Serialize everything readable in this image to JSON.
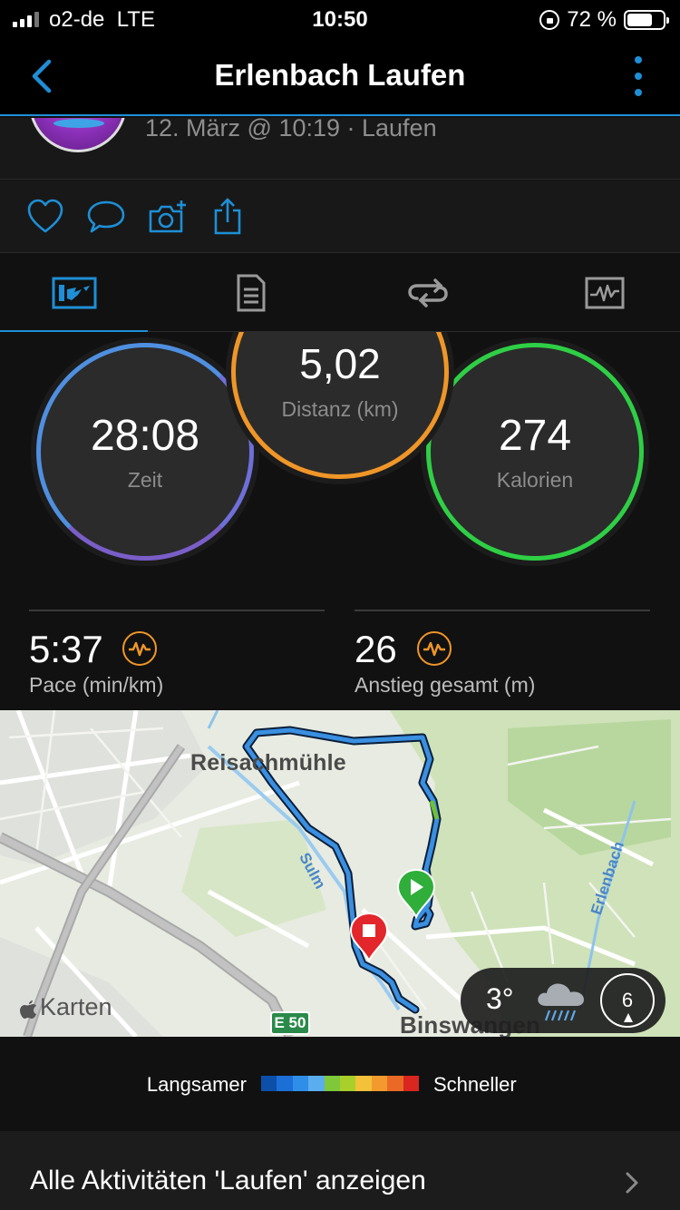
{
  "status_bar": {
    "carrier": "o2-de",
    "network": "LTE",
    "time": "10:50",
    "battery": "72 %",
    "battery_level": 0.72
  },
  "nav": {
    "title": "Erlenbach Laufen",
    "back_icon": "chevron-left-icon",
    "more_icon": "more-vertical-icon"
  },
  "activity": {
    "subtitle": "12. März @ 10:19 · Laufen"
  },
  "actions": [
    {
      "name": "like",
      "icon": "heart-icon"
    },
    {
      "name": "comment",
      "icon": "comment-icon"
    },
    {
      "name": "add-photo",
      "icon": "camera-plus-icon"
    },
    {
      "name": "share",
      "icon": "share-icon"
    }
  ],
  "tabs": [
    {
      "name": "overview",
      "icon": "overview-icon",
      "active": true
    },
    {
      "name": "details",
      "icon": "document-icon",
      "active": false
    },
    {
      "name": "laps",
      "icon": "laps-icon",
      "active": false
    },
    {
      "name": "charts",
      "icon": "chart-icon",
      "active": false
    }
  ],
  "stats": {
    "time": {
      "value": "28:08",
      "label": "Zeit"
    },
    "distance": {
      "value": "5,02",
      "label": "Distanz (km)"
    },
    "calories": {
      "value": "274",
      "label": "Kalorien"
    },
    "pace": {
      "value": "5:37",
      "label": "Pace (min/km)"
    },
    "ascent": {
      "value": "26",
      "label": "Anstieg gesamt (m)"
    }
  },
  "map": {
    "places": {
      "reisachmuehle": "Reisachmühle",
      "sulm": "Sulm",
      "erlenbach": "Erlenbach",
      "binswangen": "Binswangen"
    },
    "attribution": "Karten",
    "road_shield": "E 50",
    "weather": {
      "temperature": "3°",
      "icon": "rain-cloud-icon",
      "wind": "6"
    }
  },
  "legend": {
    "slower": "Langsamer",
    "faster": "Schneller",
    "colors": [
      "#0b4fa8",
      "#1c6fd6",
      "#2f8fe8",
      "#5aaef0",
      "#7fc83a",
      "#a8cf2a",
      "#f3c13a",
      "#f29a2e",
      "#ea6a25",
      "#d9261f"
    ]
  },
  "footer": {
    "link": "Alle Aktivitäten 'Laufen' anzeigen"
  }
}
